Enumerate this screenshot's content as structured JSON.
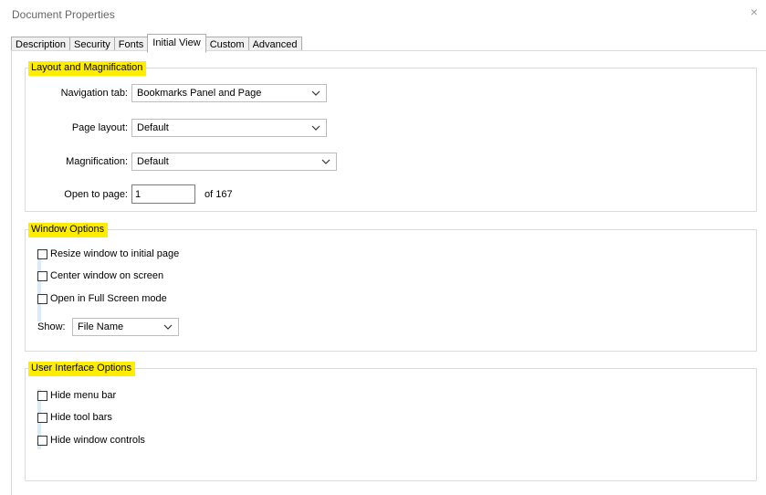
{
  "window": {
    "title": "Document Properties",
    "close_glyph": "×"
  },
  "tabs": [
    "Description",
    "Security",
    "Fonts",
    "Initial View",
    "Custom",
    "Advanced"
  ],
  "active_tab": "Initial View",
  "highlight_color": "#ffed00",
  "layout": {
    "legend": "Layout and Magnification",
    "navigation_tab": {
      "label": "Navigation tab:",
      "value": "Bookmarks Panel and Page"
    },
    "page_layout": {
      "label": "Page layout:",
      "value": "Default"
    },
    "magnification": {
      "label": "Magnification:",
      "value": "Default"
    },
    "open_to_page": {
      "label": "Open to page:",
      "value": "1",
      "of_text": "of 167"
    }
  },
  "window_options": {
    "legend": "Window Options",
    "checkboxes": [
      {
        "label": "Resize window to initial page",
        "checked": false
      },
      {
        "label": "Center window on screen",
        "checked": false
      },
      {
        "label": "Open in Full Screen mode",
        "checked": false
      }
    ],
    "show": {
      "label": "Show:",
      "value": "File Name"
    }
  },
  "ui_options": {
    "legend": "User Interface Options",
    "checkboxes": [
      {
        "label": "Hide menu bar",
        "checked": false
      },
      {
        "label": "Hide tool bars",
        "checked": false
      },
      {
        "label": "Hide window controls",
        "checked": false
      }
    ]
  }
}
